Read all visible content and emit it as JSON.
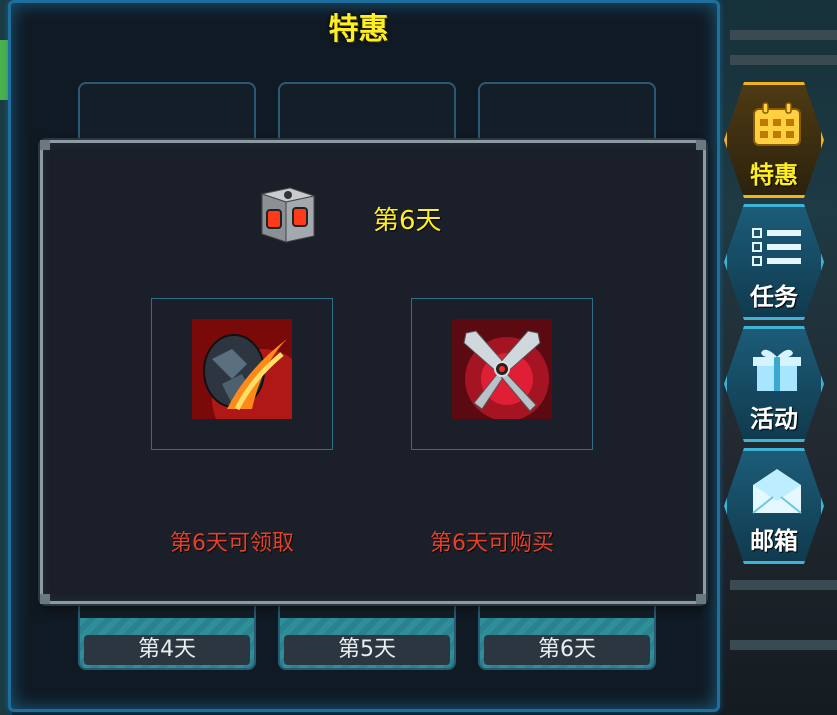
{
  "main_title": "特惠",
  "cards": [
    {
      "day_label": "第4天"
    },
    {
      "day_label": "第5天"
    },
    {
      "day_label": "第6天"
    }
  ],
  "popup": {
    "day_title": "第6天",
    "left_label": "第6天可领取",
    "right_label": "第6天可购买",
    "left_icon": "flame-egg-icon",
    "right_icon": "crossed-blades-icon",
    "title_icon": "crate-icon"
  },
  "tabs": [
    {
      "label": "特惠",
      "icon": "calendar-icon",
      "active": true
    },
    {
      "label": "任务",
      "icon": "list-icon",
      "active": false
    },
    {
      "label": "活动",
      "icon": "gift-icon",
      "active": false
    },
    {
      "label": "邮箱",
      "icon": "mail-icon",
      "active": false
    }
  ],
  "colors": {
    "title_yellow": "#ffee22",
    "label_red": "#e3412a",
    "frame_blue": "#1f6f9c",
    "tab_active_gold": "#f0b21e"
  }
}
